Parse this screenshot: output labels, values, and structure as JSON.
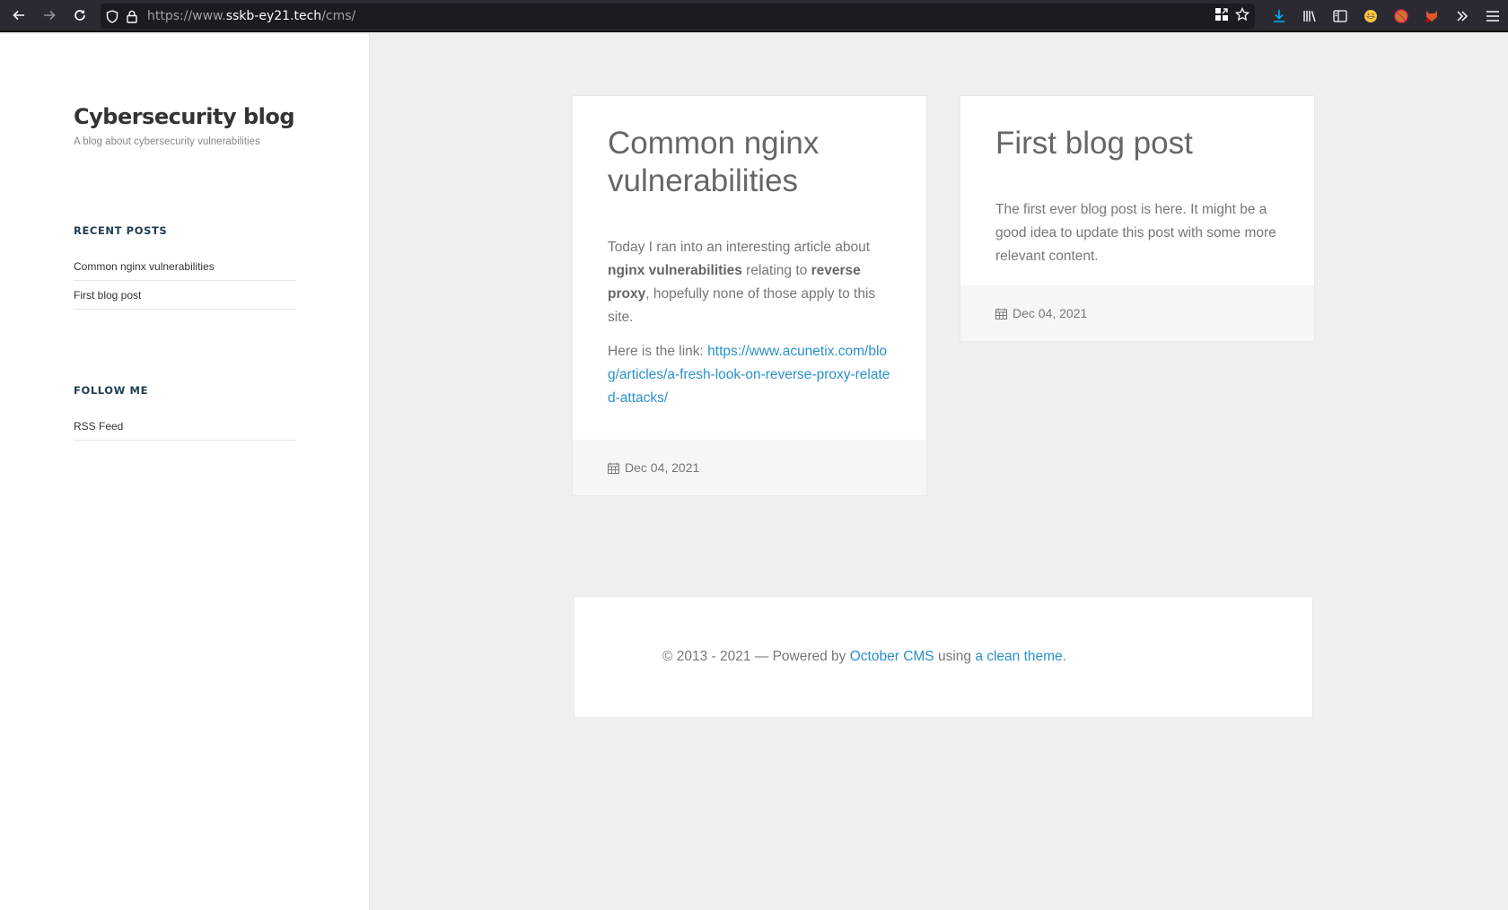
{
  "browser": {
    "url_prefix": "https://www.",
    "url_host": "sskb-ey21.tech",
    "url_path": "/cms/"
  },
  "sidebar": {
    "site_title": "Cybersecurity blog",
    "site_subtitle": "A blog about cybersecurity vulnerabilities",
    "recent_posts_heading": "RECENT POSTS",
    "recent_posts": [
      {
        "label": "Common nginx vulnerabilities"
      },
      {
        "label": "First blog post"
      }
    ],
    "follow_heading": "FOLLOW ME",
    "follow_links": [
      {
        "label": "RSS Feed"
      }
    ]
  },
  "posts": [
    {
      "title": "Common nginx vulnerabilities",
      "p1_a": "Today I ran into an interesting article about ",
      "p1_b1": "nginx vulnerabilities",
      "p1_c": " relating to ",
      "p1_b2": "reverse proxy",
      "p1_d": ", hopefully none of those apply to this site.",
      "p2_label": "Here is the link: ",
      "p2_link": "https://www.acunetix.com/blog/articles/a-fresh-look-on-reverse-proxy-related-attacks/",
      "date": "Dec 04, 2021"
    },
    {
      "title": "First blog post",
      "excerpt": "The first ever blog post is here. It might be a good idea to update this post with some more relevant content.",
      "date": "Dec 04, 2021"
    }
  ],
  "footer": {
    "prefix": "© 2013 - 2021 — Powered by ",
    "cms_link": "October CMS",
    "middle": " using ",
    "theme_link": "a clean theme",
    "suffix": "."
  }
}
